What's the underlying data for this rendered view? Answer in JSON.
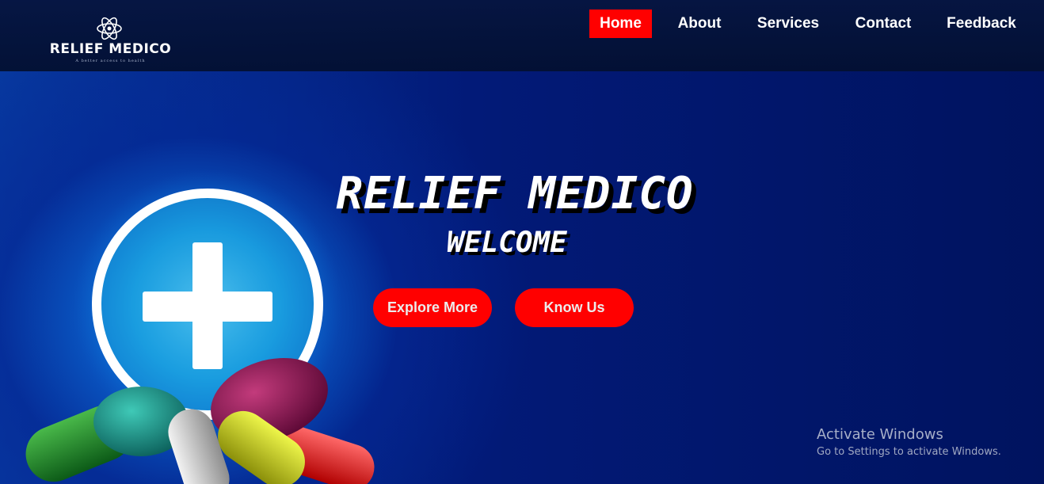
{
  "brand": {
    "name": "RELIEF MEDICO",
    "tagline": "A better access to health"
  },
  "nav": {
    "items": [
      {
        "label": "Home",
        "active": true
      },
      {
        "label": "About",
        "active": false
      },
      {
        "label": "Services",
        "active": false
      },
      {
        "label": "Contact",
        "active": false
      },
      {
        "label": "Feedback",
        "active": false
      }
    ]
  },
  "hero": {
    "title": "RELIEF MEDICO",
    "subtitle": "WELCOME",
    "buttons": {
      "explore": "Explore More",
      "know": "Know Us"
    }
  },
  "watermark": {
    "title": "Activate Windows",
    "subtitle": "Go to Settings to activate Windows."
  },
  "colors": {
    "accent": "#ff0000",
    "nav_bg": "#051338",
    "hero_bg": "#021a78"
  },
  "icons": [
    "atom-logo-icon",
    "medical-cross-icon",
    "pills-icon"
  ]
}
